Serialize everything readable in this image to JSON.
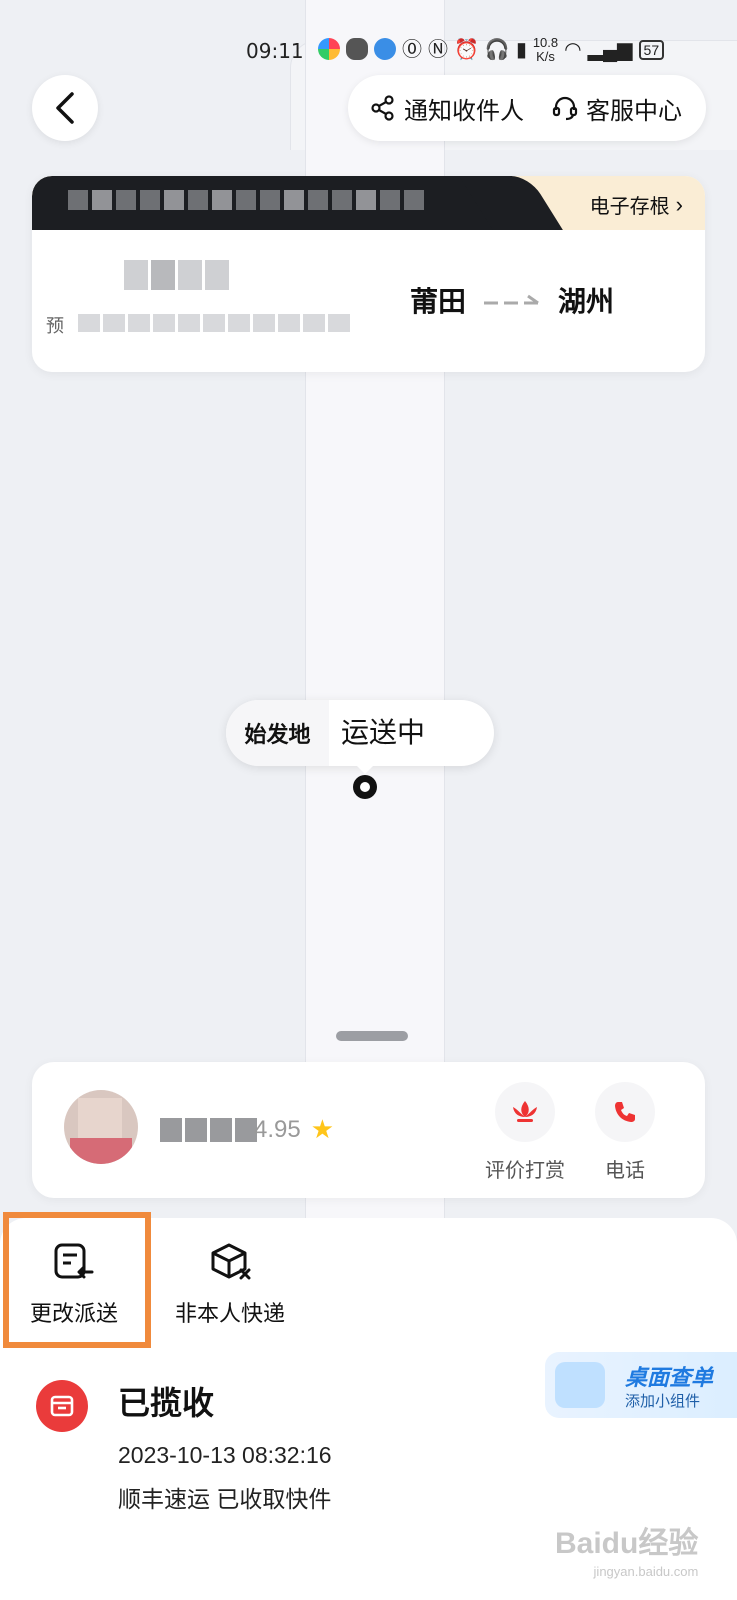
{
  "status_bar": {
    "time": "09:11",
    "net_speed_value": "10.8",
    "net_speed_unit": "K/s",
    "battery": "57"
  },
  "header": {
    "notify_label": "通知收件人",
    "service_label": "客服中心"
  },
  "shipment": {
    "stub_label": "电子存根",
    "predicted_prefix": "预",
    "origin": "莆田",
    "destination": "湖州"
  },
  "map": {
    "origin_tag": "始发地",
    "status_tag": "运送中"
  },
  "courier": {
    "rating": "4.95",
    "reward_label": "评价打赏",
    "phone_label": "电话"
  },
  "actions": {
    "change_delivery_label": "更改派送",
    "not_mine_label": "非本人快递"
  },
  "widget": {
    "title": "桌面查单",
    "subtitle": "添加小组件"
  },
  "status": {
    "title": "已揽收",
    "time": "2023-10-13 08:32:16",
    "description": "顺丰速运 已收取快件"
  },
  "watermark": {
    "brand": "Baidu经验",
    "url": "jingyan.baidu.com"
  },
  "colors": {
    "accent_red": "#ea3b3b",
    "highlight_orange": "#f08a3c",
    "stub_bg": "#faedd5",
    "widget_blue": "#1f7ae0"
  }
}
